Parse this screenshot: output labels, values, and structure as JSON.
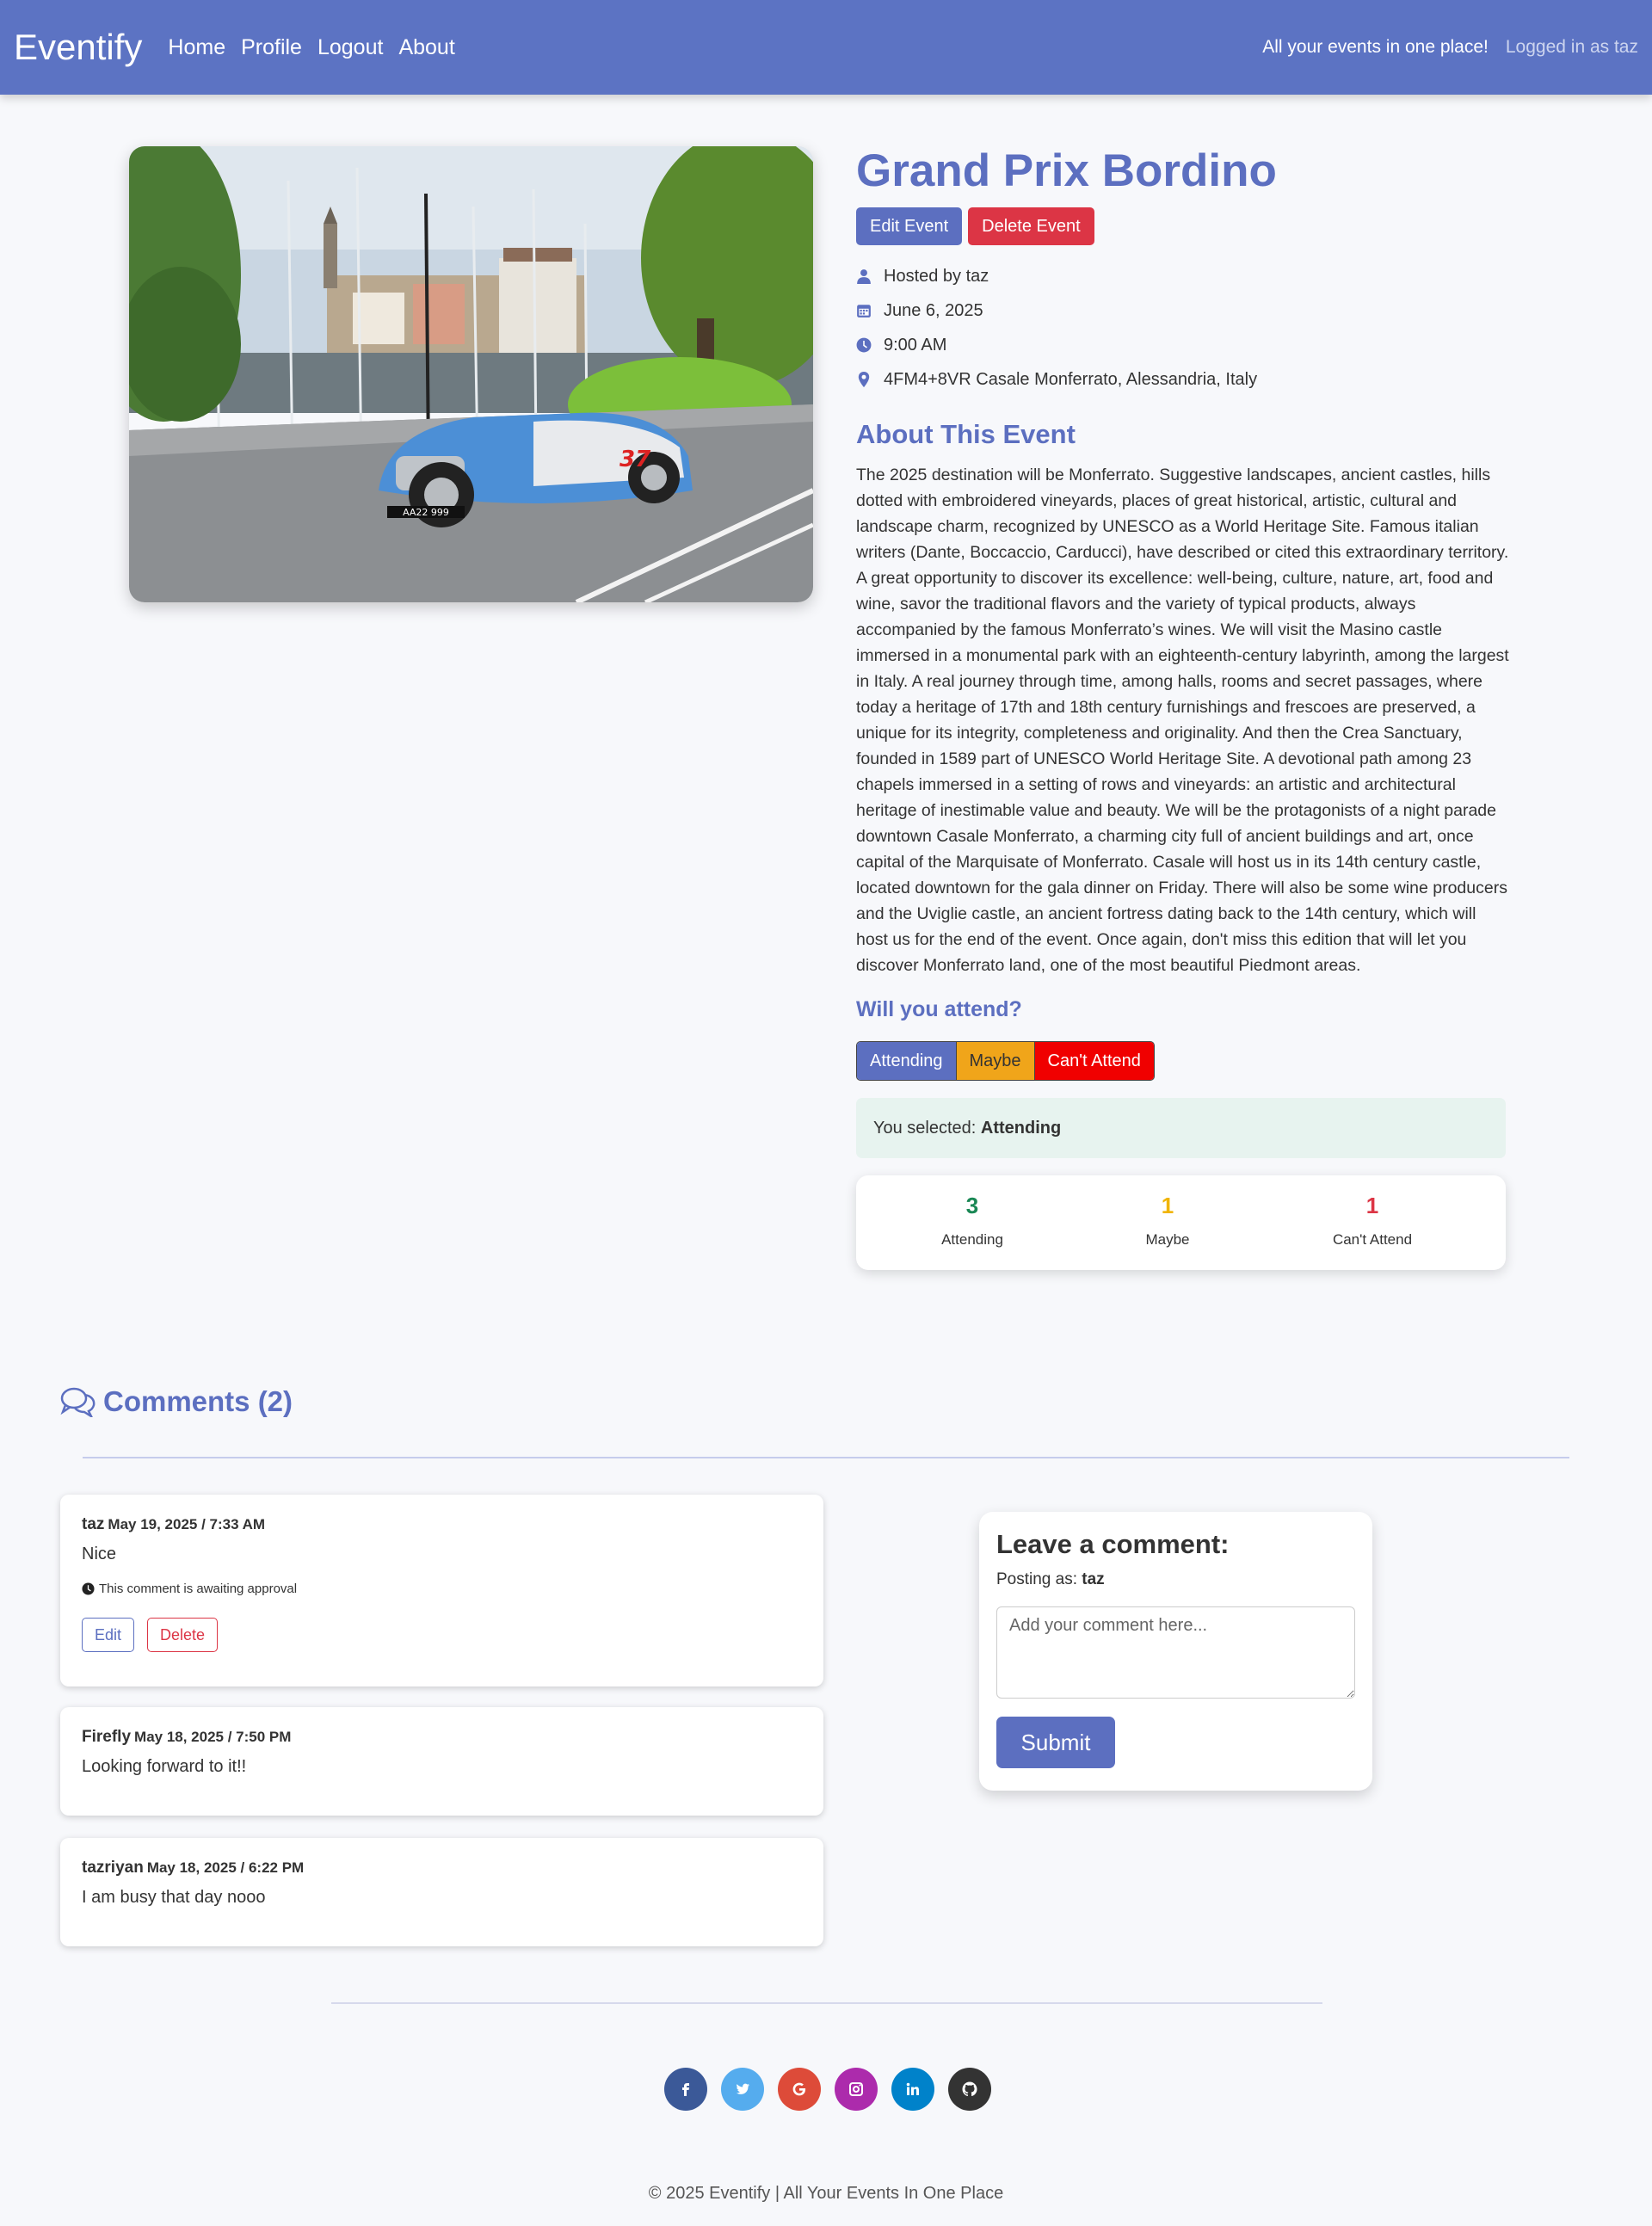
{
  "nav": {
    "brand": "Eventify",
    "links": [
      "Home",
      "Profile",
      "Logout",
      "About"
    ],
    "tagline": "All your events in one place!",
    "logged_in": "Logged in as taz"
  },
  "event": {
    "title": "Grand Prix Bordino",
    "edit_label": "Edit Event",
    "delete_label": "Delete Event",
    "host": "Hosted by taz",
    "date": "June 6, 2025",
    "time": "9:00 AM",
    "location": "4FM4+8VR Casale Monferrato, Alessandria, Italy",
    "about_heading": "About This Event",
    "description": "The 2025 destination will be Monferrato. Suggestive landscapes, ancient castles, hills dotted with embroidered vineyards, places of great historical, artistic, cultural and landscape charm, recognized by UNESCO as a World Heritage Site. Famous italian writers (Dante, Boccaccio, Carducci), have described or cited this extraordinary territory. A great opportunity to discover its excellence: well-being, culture, nature, art, food and wine, savor the traditional flavors and the variety of typical products, always accompanied by the famous Monferrato’s wines. We will visit the Masino castle immersed in a monumental park with an eighteenth-century labyrinth, among the largest in Italy. A real journey through time, among halls, rooms and secret passages, where today a heritage of 17th and 18th century furnishings and frescoes are preserved, a unique for its integrity, completeness and originality. And then the Crea Sanctuary, founded in 1589 part of UNESCO World Heritage Site. A devotional path among 23 chapels immersed in a setting of rows and vineyards: an artistic and architectural heritage of inestimable value and beauty. We will be the protagonists of a night parade downtown Casale Monferrato, a charming city full of ancient buildings and art, once capital of the Marquisate of Monferrato. Casale will host us in its 14th century castle, located downtown for the gala dinner on Friday. There will also be some wine producers and the Uviglie castle, an ancient fortress dating back to the 14th century, which will host us for the end of the event. Once again, don't miss this edition that will let you discover Monferrato land, one of the most beautiful Piedmont areas.",
    "image_plate": "AA22 999"
  },
  "rsvp": {
    "heading": "Will you attend?",
    "options": [
      "Attending",
      "Maybe",
      "Can't Attend"
    ],
    "selected_prefix": "You selected: ",
    "selected_value": "Attending",
    "counts": [
      {
        "value": "3",
        "label": "Attending",
        "color": "#198754"
      },
      {
        "value": "1",
        "label": "Maybe",
        "color": "#f0b400"
      },
      {
        "value": "1",
        "label": "Can't Attend",
        "color": "#dc3545"
      }
    ]
  },
  "comments": {
    "heading": "Comments (2)",
    "items": [
      {
        "author": "taz",
        "date": "May 19, 2025 / 7:33 AM",
        "text": "Nice",
        "awaiting": "This comment is awaiting approval",
        "edit": "Edit",
        "delete": "Delete"
      },
      {
        "author": "Firefly",
        "date": "May 18, 2025 / 7:50 PM",
        "text": "Looking forward to it!!"
      },
      {
        "author": "tazriyan",
        "date": "May 18, 2025 / 6:22 PM",
        "text": "I am busy that day nooo"
      }
    ],
    "form": {
      "heading": "Leave a comment:",
      "posting_prefix": "Posting as: ",
      "posting_user": "taz",
      "placeholder": "Add your comment here...",
      "submit": "Submit"
    }
  },
  "footer": {
    "socials": [
      {
        "icon": "facebook-icon",
        "color": "#3b5998"
      },
      {
        "icon": "twitter-icon",
        "color": "#55acee"
      },
      {
        "icon": "google-icon",
        "color": "#dd4b39"
      },
      {
        "icon": "instagram-icon",
        "color": "#ac2bac"
      },
      {
        "icon": "linkedin-icon",
        "color": "#0082ca"
      },
      {
        "icon": "github-icon",
        "color": "#333333"
      }
    ],
    "copyright": "© 2025 Eventify | All Your Events In One Place"
  }
}
